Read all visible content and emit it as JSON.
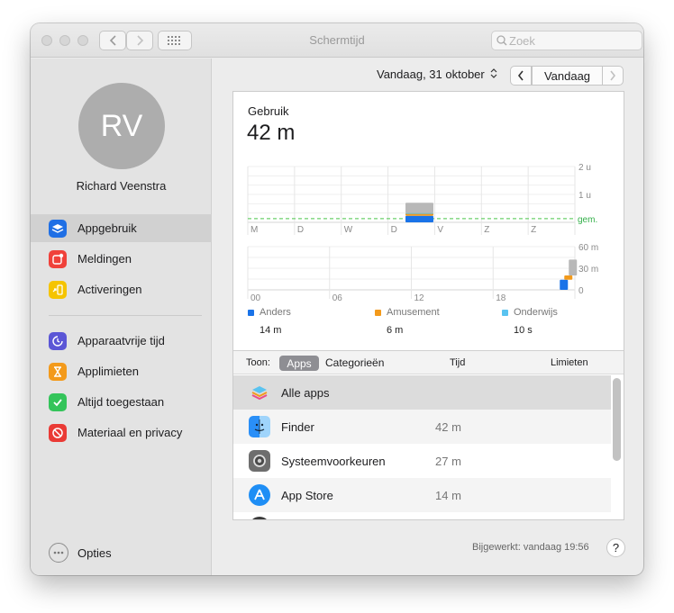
{
  "window": {
    "title": "Schermtijd"
  },
  "search": {
    "placeholder": "Zoek"
  },
  "user": {
    "initials": "RV",
    "name": "Richard Veenstra"
  },
  "sidebar": {
    "items": [
      {
        "label": "Appgebruik",
        "icon": "layers-icon",
        "color": "#1f6fe5",
        "selected": true
      },
      {
        "label": "Meldingen",
        "icon": "notification-icon",
        "color": "#f0413a",
        "selected": false
      },
      {
        "label": "Activeringen",
        "icon": "pickup-icon",
        "color": "#f5c400",
        "selected": false
      },
      {
        "label": "Apparaatvrije tijd",
        "icon": "downtime-icon",
        "color": "#5b56d6",
        "selected": false
      },
      {
        "label": "Applimieten",
        "icon": "hourglass-icon",
        "color": "#f39a1b",
        "selected": false
      },
      {
        "label": "Altijd toegestaan",
        "icon": "checkmark-icon",
        "color": "#34c45a",
        "selected": false
      },
      {
        "label": "Materiaal en privacy",
        "icon": "no-entry-icon",
        "color": "#ea3a35",
        "selected": false
      }
    ],
    "options_label": "Opties"
  },
  "datebar": {
    "date_label": "Vandaag, 31 oktober",
    "today_label": "Vandaag"
  },
  "usage": {
    "title": "Gebruik",
    "total": "42 m"
  },
  "chart_data": [
    {
      "type": "bar",
      "categories": [
        "M",
        "D",
        "W",
        "D",
        "V",
        "Z",
        "Z"
      ],
      "series": [
        {
          "name": "Anders",
          "values": [
            0,
            0,
            0,
            14,
            0,
            0,
            0
          ]
        },
        {
          "name": "Amusement",
          "values": [
            0,
            0,
            0,
            6,
            0,
            0,
            0
          ]
        },
        {
          "name": "Onderwijs",
          "values": [
            0,
            0,
            0,
            0.17,
            0,
            0,
            0
          ]
        },
        {
          "name": "",
          "values": [
            0,
            0,
            0,
            22,
            0,
            0,
            0
          ]
        }
      ],
      "yticks": [
        "2 u",
        "1 u"
      ],
      "ylim": [
        0,
        120
      ],
      "average_label": "gem.",
      "average_value": 8
    },
    {
      "type": "bar",
      "categories": [
        "00",
        "06",
        "12",
        "18"
      ],
      "series": [
        {
          "name": "Anders",
          "values": [
            0,
            0,
            0,
            14
          ]
        },
        {
          "name": "Amusement",
          "values": [
            0,
            0,
            0,
            6
          ]
        },
        {
          "name": "",
          "values": [
            0,
            0,
            0,
            22
          ]
        }
      ],
      "yticks": [
        "60 m",
        "30 m",
        "0"
      ],
      "ylim": [
        0,
        60
      ]
    }
  ],
  "legend": [
    {
      "name": "Anders",
      "value": "14 m",
      "color": "#1a73e8"
    },
    {
      "name": "Amusement",
      "value": "6 m",
      "color": "#f39a1b"
    },
    {
      "name": "Onderwijs",
      "value": "10 s",
      "color": "#5ac3f0"
    }
  ],
  "table": {
    "show_label": "Toon:",
    "seg_apps": "Apps",
    "seg_categories": "Categorieën",
    "col_time": "Tijd",
    "col_limits": "Limieten",
    "rows": [
      {
        "name": "Alle apps",
        "time": "",
        "icon": "all-apps-icon"
      },
      {
        "name": "Finder",
        "time": "42 m",
        "icon": "finder-icon"
      },
      {
        "name": "Systeemvoorkeuren",
        "time": "27 m",
        "icon": "system-preferences-icon"
      },
      {
        "name": "App Store",
        "time": "14 m",
        "icon": "app-store-icon"
      }
    ]
  },
  "footer": {
    "updated": "Bijgewerkt: vandaag 19:56",
    "help": "?"
  }
}
